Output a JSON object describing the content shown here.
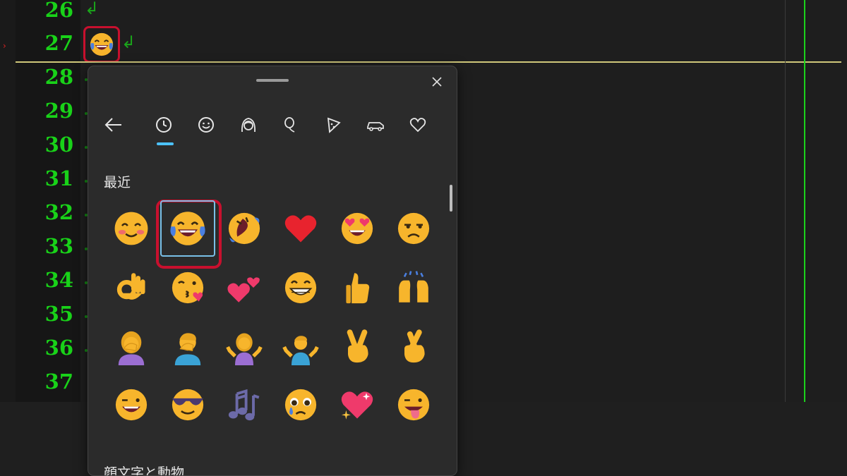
{
  "editor": {
    "line_numbers": [
      "26",
      "27",
      "28",
      "29",
      "30",
      "31",
      "32",
      "33",
      "34",
      "35",
      "36",
      "37"
    ],
    "return_mark": "↲",
    "inline_emoji_icon": "face-with-tears-of-joy-icon"
  },
  "panel": {
    "tabs": [
      "recent-clock-icon",
      "smiley-icon",
      "people-icon",
      "balloon-icon",
      "pizza-icon",
      "car-icon",
      "heart-outline-icon"
    ],
    "active_tab": "recent-clock-icon",
    "section_recent": "最近",
    "section_kaomoji": "顔文字と動物",
    "accent_color": "#4cc2ff",
    "highlight_color": "#c8102e",
    "emojis": [
      "smiling-face-with-blush-icon",
      "face-with-tears-of-joy-icon",
      "rolling-on-floor-laughing-icon",
      "red-heart-icon",
      "heart-eyes-icon",
      "pleading-sad-face-icon",
      "ok-hand-icon",
      "kissing-face-with-heart-icon",
      "two-hearts-icon",
      "grinning-face-icon",
      "thumbs-up-icon",
      "raising-hands-icon",
      "woman-facepalming-icon",
      "man-facepalming-icon",
      "woman-shrugging-icon",
      "man-shrugging-icon",
      "victory-hand-icon",
      "crossed-fingers-icon",
      "winking-face-icon",
      "sunglasses-face-icon",
      "music-notes-icon",
      "teary-face-icon",
      "sparkling-heart-icon",
      "tongue-out-face-icon"
    ]
  }
}
